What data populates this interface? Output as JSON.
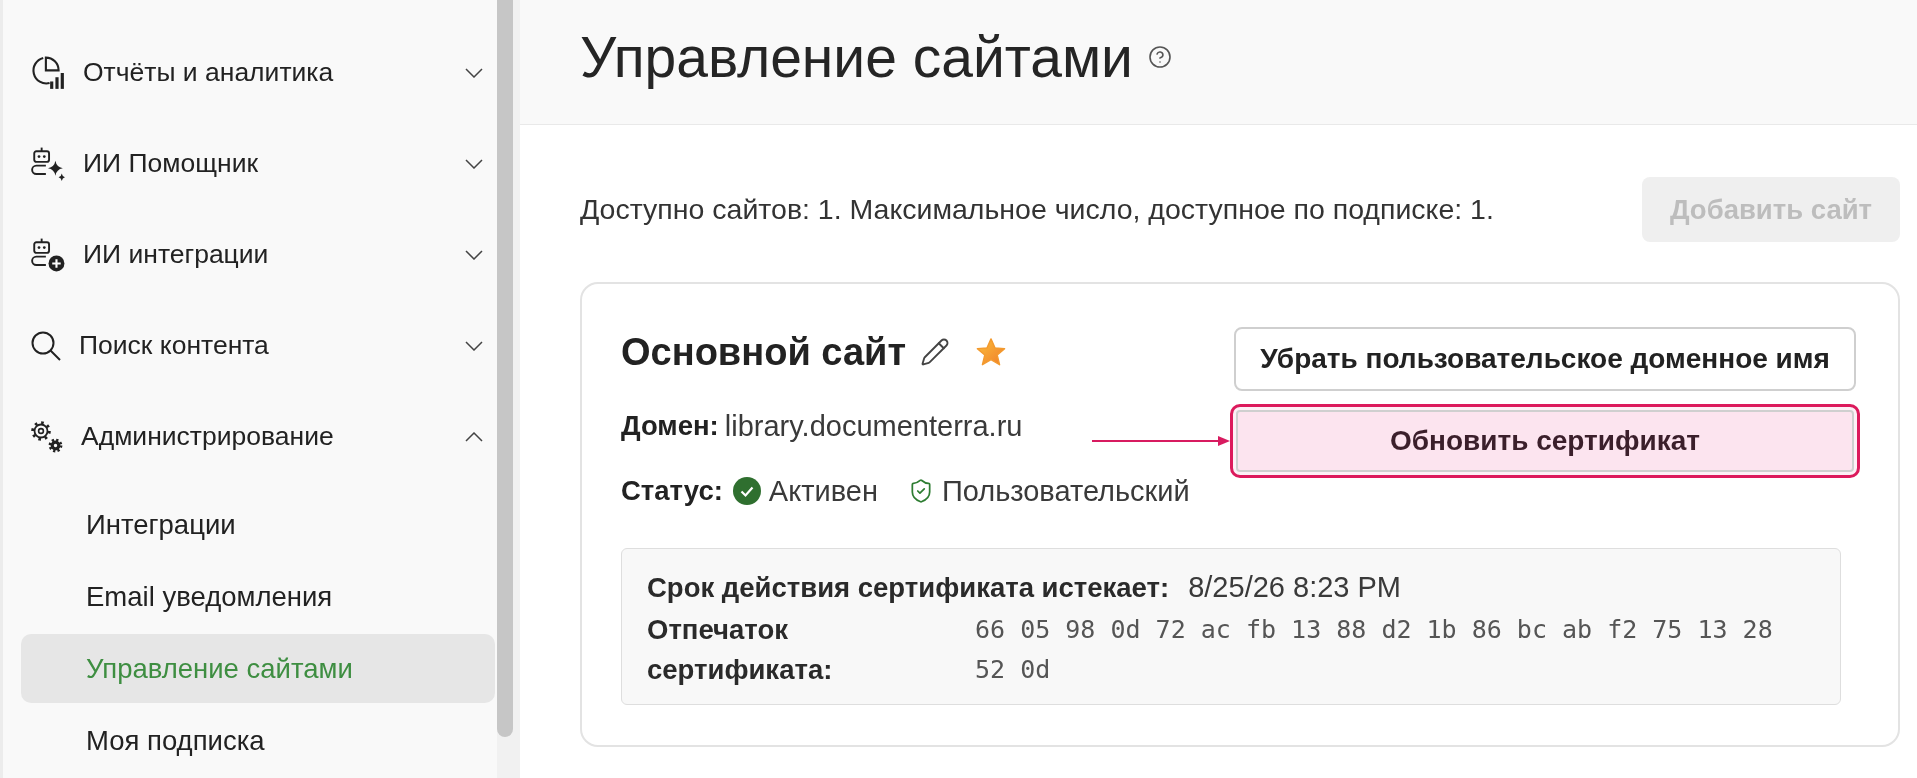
{
  "sidebar": {
    "items": [
      {
        "kind": "reports",
        "label": "Отчёты и аналитика",
        "expanded": false
      },
      {
        "kind": "assistant",
        "label": "ИИ Помощник",
        "expanded": false
      },
      {
        "kind": "integrations",
        "label": "ИИ интеграции",
        "expanded": false
      },
      {
        "kind": "search",
        "label": "Поиск контента",
        "expanded": false
      },
      {
        "kind": "admin",
        "label": "Администрирование",
        "expanded": true,
        "children": [
          {
            "label": "Интеграции",
            "selected": false
          },
          {
            "label": "Email уведомления",
            "selected": false
          },
          {
            "label": "Управление сайтами",
            "selected": true
          },
          {
            "label": "Моя подписка",
            "selected": false
          }
        ]
      }
    ]
  },
  "header": {
    "title": "Управление сайтами"
  },
  "summary": {
    "text": "Доступно сайтов: 1. Максимальное число, доступное по подписке: 1.",
    "add_button": {
      "label": "Добавить сайт",
      "disabled": true
    }
  },
  "site_card": {
    "title": "Основной сайт",
    "favorite": true,
    "domain": {
      "label": "Домен:",
      "value": "library.documenterra.ru"
    },
    "status": {
      "label": "Статус:",
      "value": "Активен",
      "active": true,
      "type_label": "Пользовательский"
    },
    "buttons": [
      {
        "label": "Убрать пользовательское доменное имя",
        "highlighted": false
      },
      {
        "label": "Обновить сертификат",
        "highlighted": true
      }
    ],
    "certificate": {
      "expiry_label": "Срок действия сертификата истекает:",
      "expiry_value": "8/25/26 8:23 PM",
      "fingerprint_label": "Отпечаток сертификата:",
      "fingerprint_value": "66 05 98 0d 72 ac fb 13 88 d2 1b 86 bc ab f2 75 13 28 52 0d"
    }
  }
}
